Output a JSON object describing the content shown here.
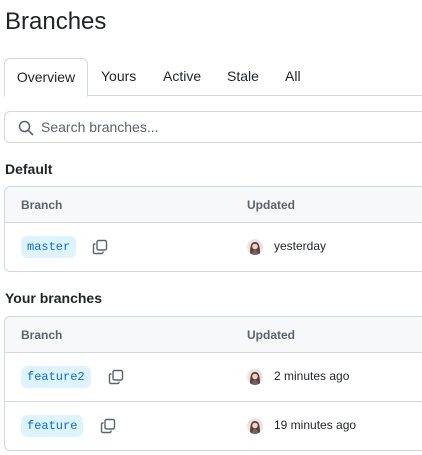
{
  "page": {
    "title": "Branches"
  },
  "tabs": [
    {
      "label": "Overview",
      "active": true
    },
    {
      "label": "Yours",
      "active": false
    },
    {
      "label": "Active",
      "active": false
    },
    {
      "label": "Stale",
      "active": false
    },
    {
      "label": "All",
      "active": false
    }
  ],
  "search": {
    "placeholder": "Search branches...",
    "value": ""
  },
  "sections": {
    "default": {
      "title": "Default",
      "columns": {
        "branch": "Branch",
        "updated": "Updated"
      },
      "rows": [
        {
          "branch": "master",
          "updated": "yesterday"
        }
      ]
    },
    "yours": {
      "title": "Your branches",
      "columns": {
        "branch": "Branch",
        "updated": "Updated"
      },
      "rows": [
        {
          "branch": "feature2",
          "updated": "2 minutes ago"
        },
        {
          "branch": "feature",
          "updated": "19 minutes ago"
        }
      ]
    }
  },
  "icons": {
    "search": "search-icon",
    "copy": "copy-icon",
    "avatar": "user-avatar"
  },
  "colors": {
    "branch_pill_bg": "#ddf4ff",
    "branch_pill_text": "#0969da",
    "border": "#d0d7de",
    "header_bg": "#f6f8fa"
  }
}
